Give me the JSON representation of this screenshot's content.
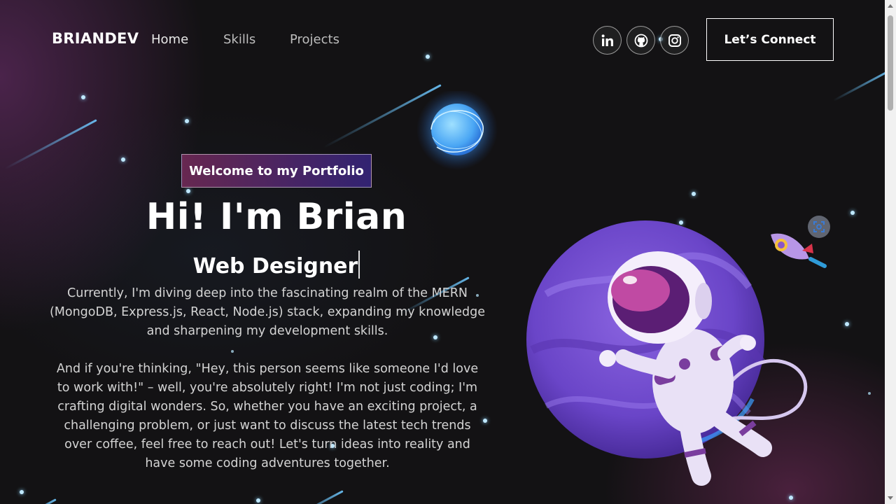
{
  "nav": {
    "logo": "BRIANDEV",
    "links": [
      "Home",
      "Skills",
      "Projects"
    ],
    "social": [
      {
        "name": "linkedin",
        "icon": "linkedin-icon"
      },
      {
        "name": "github",
        "icon": "github-icon"
      },
      {
        "name": "instagram",
        "icon": "instagram-icon"
      }
    ],
    "connect_label": "Let’s Connect"
  },
  "hero": {
    "tagline": "Welcome to my Portfolio",
    "title": "Hi! I'm Brian",
    "role": "Web Designer",
    "paragraph1": "Currently, I'm diving deep into the fascinating realm of the MERN (MongoDB, Express.js, React, Node.js) stack, expanding my knowledge and sharpening my development skills.",
    "paragraph2": "And if you're thinking, \"Hey, this person seems like someone I'd love to work with!\" – well, you're absolutely right! I'm not just coding; I'm crafting digital wonders. So, whether you have an exciting project, a challenging problem, or just want to discuss the latest tech trends over coffee, feel free to reach out! Let's turn ideas into reality and have some coding adventures together."
  },
  "colors": {
    "background": "#121212",
    "tag_gradient_start": "#aa367c",
    "tag_gradient_end": "#4a2fbd",
    "planet": "#6a45c8",
    "star": "#bfe8ff"
  },
  "icons": {
    "scan": "scan-icon",
    "planet": "planet-illustration",
    "astronaut": "astronaut-illustration",
    "rocket": "rocket-illustration",
    "moon": "glowing-moon-illustration"
  }
}
